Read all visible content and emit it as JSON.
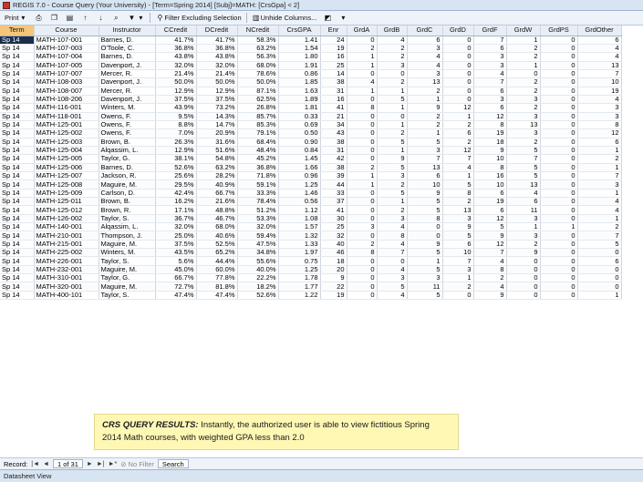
{
  "window": {
    "title": "REGIS 7.0 - Course Query (Your University) - [Term=Spring 2014] [Subj]=MATH: [CrsGpa] < 2]"
  },
  "toolbar": {
    "print_label": "Print",
    "filter_excluding_label": "Filter Excluding Selection",
    "unhide_columns_label": "Unhide Columns..."
  },
  "grid": {
    "columns": [
      "Term",
      "Course",
      "Instructor",
      "CCredit",
      "DCredit",
      "NCredit",
      "CrsGPA",
      "Enr",
      "GrdA",
      "GrdB",
      "GrdC",
      "GrdD",
      "GrdF",
      "GrdW",
      "GrdPS",
      "GrdOther"
    ],
    "rows": [
      [
        "Sp 14",
        "MATH-107-001",
        "Barnes, D.",
        "41.7%",
        "41.7%",
        "58.3%",
        "1.41",
        "24",
        "0",
        "4",
        "6",
        "0",
        "7",
        "1",
        "0",
        "6"
      ],
      [
        "Sp 14",
        "MATH-107-003",
        "O'Toole, C.",
        "36.8%",
        "36.8%",
        "63.2%",
        "1.54",
        "19",
        "2",
        "2",
        "3",
        "0",
        "6",
        "2",
        "0",
        "4"
      ],
      [
        "Sp 14",
        "MATH-107-004",
        "Barnes, D.",
        "43.8%",
        "43.8%",
        "56.3%",
        "1.80",
        "16",
        "1",
        "2",
        "4",
        "0",
        "3",
        "2",
        "0",
        "4"
      ],
      [
        "Sp 14",
        "MATH-107-005",
        "Davenport, J.",
        "32.0%",
        "32.0%",
        "68.0%",
        "1.91",
        "25",
        "1",
        "3",
        "4",
        "0",
        "3",
        "1",
        "0",
        "13"
      ],
      [
        "Sp 14",
        "MATH-107-007",
        "Mercer, R.",
        "21.4%",
        "21.4%",
        "78.6%",
        "0.86",
        "14",
        "0",
        "0",
        "3",
        "0",
        "4",
        "0",
        "0",
        "7"
      ],
      [
        "Sp 14",
        "MATH-108-003",
        "Davenport, J.",
        "50.0%",
        "50.0%",
        "50.0%",
        "1.85",
        "38",
        "4",
        "2",
        "13",
        "0",
        "7",
        "2",
        "0",
        "10"
      ],
      [
        "Sp 14",
        "MATH-108-007",
        "Mercer, R.",
        "12.9%",
        "12.9%",
        "87.1%",
        "1.63",
        "31",
        "1",
        "1",
        "2",
        "0",
        "6",
        "2",
        "0",
        "19"
      ],
      [
        "Sp 14",
        "MATH-108-206",
        "Davenport, J.",
        "37.5%",
        "37.5%",
        "62.5%",
        "1.89",
        "16",
        "0",
        "5",
        "1",
        "0",
        "3",
        "3",
        "0",
        "4"
      ],
      [
        "Sp 14",
        "MATH-116-001",
        "Winters, M.",
        "43.9%",
        "73.2%",
        "26.8%",
        "1.81",
        "41",
        "8",
        "1",
        "9",
        "12",
        "6",
        "2",
        "0",
        "3"
      ],
      [
        "Sp 14",
        "MATH-118-001",
        "Owens, F.",
        "9.5%",
        "14.3%",
        "85.7%",
        "0.33",
        "21",
        "0",
        "0",
        "2",
        "1",
        "12",
        "3",
        "0",
        "3"
      ],
      [
        "Sp 14",
        "MATH-125-001",
        "Owens, F.",
        "8.8%",
        "14.7%",
        "85.3%",
        "0.69",
        "34",
        "0",
        "1",
        "2",
        "2",
        "8",
        "13",
        "0",
        "8"
      ],
      [
        "Sp 14",
        "MATH-125-002",
        "Owens, F.",
        "7.0%",
        "20.9%",
        "79.1%",
        "0.50",
        "43",
        "0",
        "2",
        "1",
        "6",
        "19",
        "3",
        "0",
        "12"
      ],
      [
        "Sp 14",
        "MATH-125-003",
        "Brown, B.",
        "26.3%",
        "31.6%",
        "68.4%",
        "0.90",
        "38",
        "0",
        "5",
        "5",
        "2",
        "18",
        "2",
        "0",
        "6"
      ],
      [
        "Sp 14",
        "MATH-125-004",
        "Alqassim, L.",
        "12.9%",
        "51.6%",
        "48.4%",
        "0.84",
        "31",
        "0",
        "1",
        "3",
        "12",
        "9",
        "5",
        "0",
        "1"
      ],
      [
        "Sp 14",
        "MATH-125-005",
        "Taylor, G.",
        "38.1%",
        "54.8%",
        "45.2%",
        "1.45",
        "42",
        "0",
        "9",
        "7",
        "7",
        "10",
        "7",
        "0",
        "2"
      ],
      [
        "Sp 14",
        "MATH-125-006",
        "Barnes, D.",
        "52.6%",
        "63.2%",
        "36.8%",
        "1.66",
        "38",
        "2",
        "5",
        "13",
        "4",
        "8",
        "5",
        "0",
        "1"
      ],
      [
        "Sp 14",
        "MATH-125-007",
        "Jackson, R.",
        "25.6%",
        "28.2%",
        "71.8%",
        "0.96",
        "39",
        "1",
        "3",
        "6",
        "1",
        "16",
        "5",
        "0",
        "7"
      ],
      [
        "Sp 14",
        "MATH-125-008",
        "Maguire, M.",
        "29.5%",
        "40.9%",
        "59.1%",
        "1.25",
        "44",
        "1",
        "2",
        "10",
        "5",
        "10",
        "13",
        "0",
        "3"
      ],
      [
        "Sp 14",
        "MATH-125-009",
        "Carlson, D.",
        "42.4%",
        "66.7%",
        "33.3%",
        "1.46",
        "33",
        "0",
        "5",
        "9",
        "8",
        "6",
        "4",
        "0",
        "1"
      ],
      [
        "Sp 14",
        "MATH-125-011",
        "Brown, B.",
        "16.2%",
        "21.6%",
        "78.4%",
        "0.56",
        "37",
        "0",
        "1",
        "5",
        "2",
        "19",
        "6",
        "0",
        "4"
      ],
      [
        "Sp 14",
        "MATH-125-012",
        "Brown, R.",
        "17.1%",
        "48.8%",
        "51.2%",
        "1.12",
        "41",
        "0",
        "2",
        "5",
        "13",
        "6",
        "11",
        "0",
        "4"
      ],
      [
        "Sp 14",
        "MATH-126-002",
        "Taylor, S.",
        "36.7%",
        "46.7%",
        "53.3%",
        "1.08",
        "30",
        "0",
        "3",
        "8",
        "3",
        "12",
        "3",
        "0",
        "1"
      ],
      [
        "Sp 14",
        "MATH-140-001",
        "Alqassim, L.",
        "32.0%",
        "68.0%",
        "32.0%",
        "1.57",
        "25",
        "3",
        "4",
        "0",
        "9",
        "5",
        "1",
        "1",
        "2"
      ],
      [
        "Sp 14",
        "MATH-210-001",
        "Thompson, J.",
        "25.0%",
        "40.6%",
        "59.4%",
        "1.32",
        "32",
        "0",
        "8",
        "0",
        "5",
        "9",
        "3",
        "0",
        "7"
      ],
      [
        "Sp 14",
        "MATH-215-001",
        "Maguire, M.",
        "37.5%",
        "52.5%",
        "47.5%",
        "1.33",
        "40",
        "2",
        "4",
        "9",
        "6",
        "12",
        "2",
        "0",
        "5"
      ],
      [
        "Sp 14",
        "MATH-225-002",
        "Winters, M.",
        "43.5%",
        "65.2%",
        "34.8%",
        "1.97",
        "46",
        "8",
        "7",
        "5",
        "10",
        "7",
        "9",
        "0",
        "0"
      ],
      [
        "Sp 14",
        "MATH-226-001",
        "Taylor, S.",
        "5.6%",
        "44.4%",
        "55.6%",
        "0.75",
        "18",
        "0",
        "0",
        "1",
        "7",
        "4",
        "0",
        "0",
        "6"
      ],
      [
        "Sp 14",
        "MATH-232-001",
        "Maguire, M.",
        "45.0%",
        "60.0%",
        "40.0%",
        "1.25",
        "20",
        "0",
        "4",
        "5",
        "3",
        "8",
        "0",
        "0",
        "0"
      ],
      [
        "Sp 14",
        "MATH-310-001",
        "Taylor, G.",
        "66.7%",
        "77.8%",
        "22.2%",
        "1.78",
        "9",
        "0",
        "3",
        "3",
        "1",
        "2",
        "0",
        "0",
        "0"
      ],
      [
        "Sp 14",
        "MATH-320-001",
        "Maguire, M.",
        "72.7%",
        "81.8%",
        "18.2%",
        "1.77",
        "22",
        "0",
        "5",
        "11",
        "2",
        "4",
        "0",
        "0",
        "0"
      ],
      [
        "Sp 14",
        "MATH-400-101",
        "Taylor, S.",
        "47.4%",
        "47.4%",
        "52.6%",
        "1.22",
        "19",
        "0",
        "4",
        "5",
        "0",
        "9",
        "0",
        "0",
        "1"
      ]
    ]
  },
  "callout": {
    "heading": "CRS QUERY RESULTS:",
    "body": " Instantly, the authorized user is able to view fictitious Spring 2014 Math courses, with weighted GPA less than 2.0"
  },
  "record_nav": {
    "record_label": "Record:",
    "position": "1 of 31",
    "filter_label": "No Filter",
    "search_label": "Search"
  },
  "status": {
    "view_label": "Datasheet View"
  },
  "colors": {
    "selected_cell": "#1b2e4a",
    "sorted_header": "#f5c57a",
    "callout_bg": "#fff8b5"
  }
}
